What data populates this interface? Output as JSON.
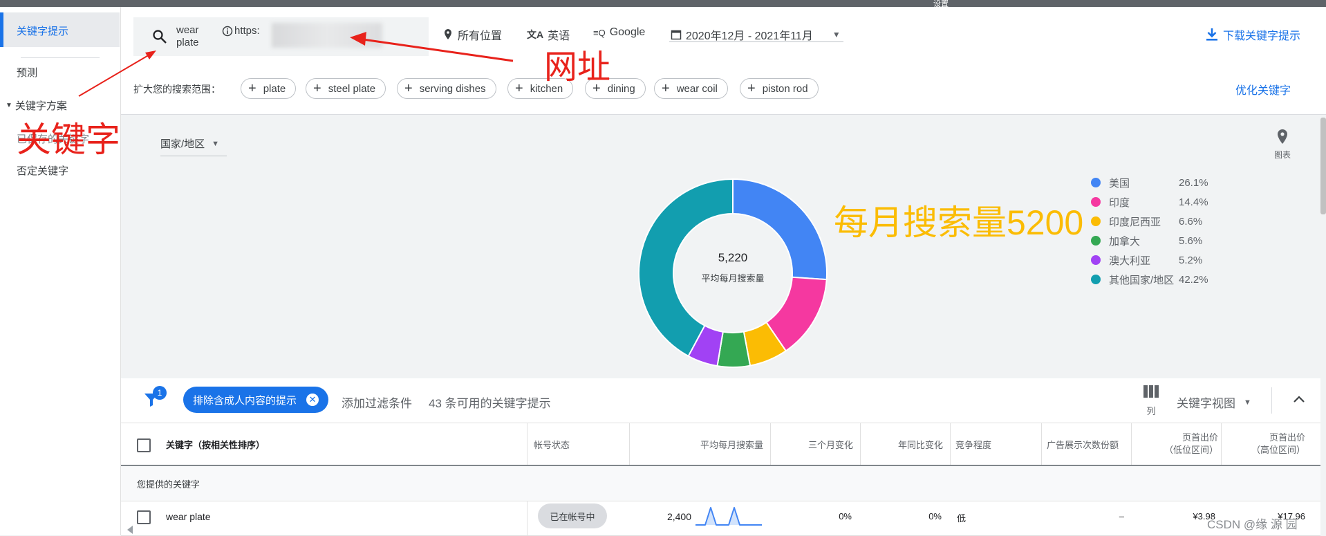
{
  "topbar": {
    "title": "设置"
  },
  "sidebar": {
    "items": [
      "关键字提示",
      "预测",
      "关键字方案",
      "已保存的关键字",
      "否定关键字"
    ]
  },
  "header": {
    "search_keyword_line1": "wear",
    "search_keyword_line2": "plate",
    "url_text": "https:",
    "location": "所有位置",
    "language": "英语",
    "network": "Google",
    "date_range": "2020年12月 - 2021年11月",
    "download": "下载关键字提示",
    "broaden_label": "扩大您的搜索范围：",
    "refine": "优化关键字",
    "chips": [
      "plate",
      "steel plate",
      "serving dishes",
      "kitchen",
      "dining",
      "wear coil",
      "piston rod"
    ]
  },
  "chart_panel": {
    "dropdown": "国家/地区",
    "view_label": "图表",
    "center_value": "5,220",
    "center_label": "平均每月搜索量"
  },
  "chart_data": {
    "type": "pie",
    "labels": [
      "美国",
      "印度",
      "印度尼西亚",
      "加拿大",
      "澳大利亚",
      "其他国家/地区"
    ],
    "values": [
      26.1,
      14.4,
      6.6,
      5.6,
      5.2,
      42.2
    ],
    "display": [
      "26.1%",
      "14.4%",
      "6.6%",
      "5.6%",
      "5.2%",
      "42.2%"
    ],
    "colors": [
      "#4285f4",
      "#f538a0",
      "#fbbc04",
      "#34a853",
      "#a142f4",
      "#129eaf"
    ],
    "legend_position": "right"
  },
  "filter_bar": {
    "filter_count": "1",
    "filter_chip": "排除含成人内容的提示",
    "add_filter": "添加过滤条件",
    "count_text": "43 条可用的关键字提示",
    "columns_label": "列",
    "view_select": "关键字视图"
  },
  "table": {
    "headers": [
      "关键字（按相关性排序）",
      "帐号状态",
      "平均每月搜索量",
      "三个月变化",
      "年同比变化",
      "竞争程度",
      "广告展示次数份额",
      "页首出价\n（低位区间）",
      "页首出价\n（高位区间）"
    ],
    "section_label": "您提供的关键字",
    "row": {
      "keyword": "wear plate",
      "status": "已在帐号中",
      "volume": "2,400",
      "three_month": "0%",
      "yoy": "0%",
      "competition": "低",
      "share": "–",
      "bid_low": "¥3.98",
      "bid_high": "¥17.96"
    }
  },
  "annotations": {
    "keyword_label": "关键字",
    "url_label": "网址",
    "volume_label": "每月搜索量5200"
  },
  "watermark": "CSDN @缘 源 园"
}
